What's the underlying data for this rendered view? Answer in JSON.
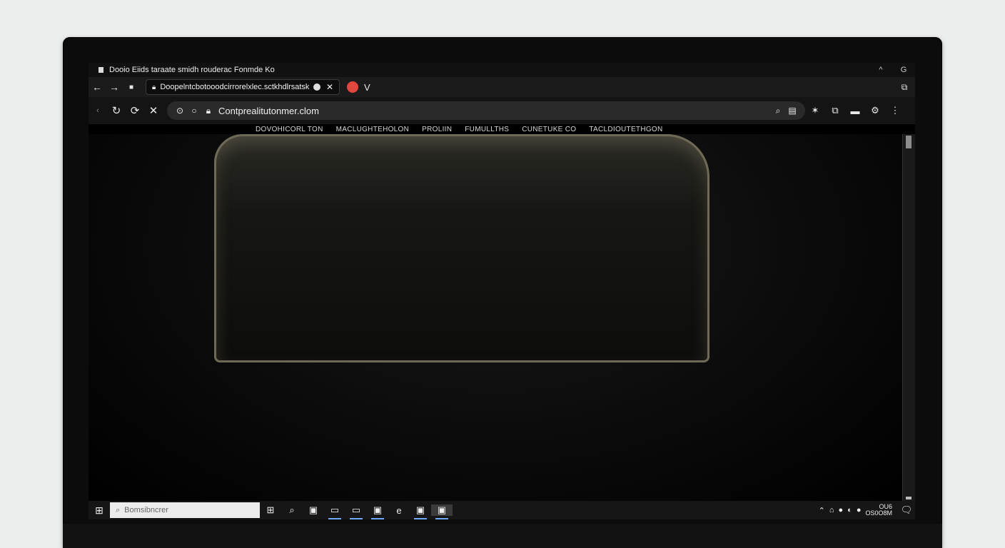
{
  "window": {
    "title": "Dooio Eiids taraate smidh rouderac Fonmde Ko",
    "controls": {
      "minimize": "^",
      "close": "G"
    }
  },
  "tabrow": {
    "back": "←",
    "forward": "→",
    "stop": "■",
    "tab": {
      "title": "Doopelntcbotooodcirrorelxlec.sctkhdlrsatskos",
      "close": "✕"
    },
    "profile_chevron": "V",
    "right_icon": "⧉"
  },
  "toolbar": {
    "url": "Contprealitutonmer.clom",
    "icons": [
      "search-icon",
      "reader-icon"
    ]
  },
  "sitenav": {
    "items": [
      "DOVOHICORL TON",
      "MACLUGHTEHOLON",
      "PROLIIN",
      "FUMULLTHS",
      "CUNETUKE CO",
      "TACLDIOUTETHGON"
    ]
  },
  "taskbar": {
    "search_placeholder": "Bomsibncrer",
    "clock_top": "OU6",
    "clock_bottom": "OS0O8M"
  },
  "colors": {
    "profile": "#e2473e",
    "active_underline": "#6aa9ff"
  }
}
